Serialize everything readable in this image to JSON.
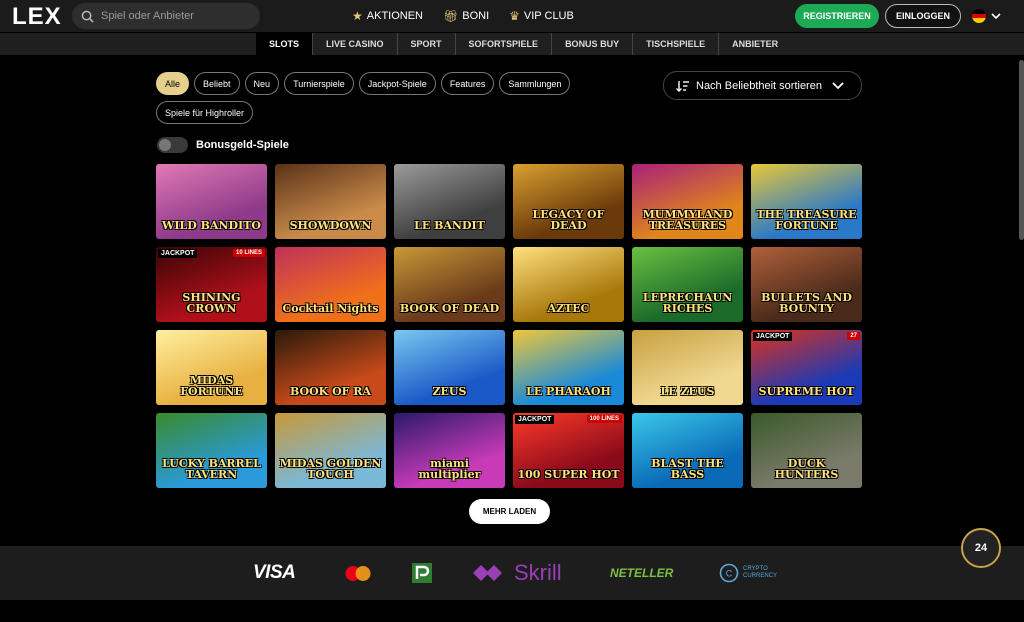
{
  "header": {
    "logo": "LEX",
    "search_placeholder": "Spiel oder Anbieter",
    "nav": [
      {
        "label": "AKTIONEN",
        "icon": "star-icon"
      },
      {
        "label": "BONI",
        "icon": "gift-icon"
      },
      {
        "label": "VIP CLUB",
        "icon": "crown-icon"
      }
    ],
    "register_label": "REGISTRIEREN",
    "login_label": "EINLOGGEN",
    "language_icon": "germany-flag-icon"
  },
  "categories": {
    "tabs": [
      "SLOTS",
      "LIVE CASINO",
      "SPORT",
      "SOFORTSPIELE",
      "BONUS BUY",
      "TISCHSPIELE",
      "ANBIETER"
    ],
    "active": "SLOTS"
  },
  "filters": {
    "chips": [
      "Alle",
      "Beliebt",
      "Neu",
      "Turnierspiele",
      "Jackpot-Spiele",
      "Features",
      "Sammlungen",
      "Spiele für Highroller"
    ],
    "active": "Alle"
  },
  "sort": {
    "label": "Nach Beliebtheit sortieren"
  },
  "bonus_toggle": {
    "label": "Bonusgeld-Spiele",
    "on": false
  },
  "games": [
    {
      "title": "WILD BANDITO",
      "bg": "#8e3a8a",
      "bg2": "#e07ab5"
    },
    {
      "title": "SHOWDOWN",
      "bg": "#c98a4a",
      "bg2": "#5a3218"
    },
    {
      "title": "LE BANDIT",
      "bg": "#3f3f3f",
      "bg2": "#9a9a9a"
    },
    {
      "title": "LEGACY OF DEAD",
      "bg": "#6b3a0a",
      "bg2": "#d8a030"
    },
    {
      "title": "MUMMYLAND TREASURES",
      "bg": "#e0861a",
      "bg2": "#a8207a"
    },
    {
      "title": "THE TREASURE FORTUNE",
      "bg": "#2a78c8",
      "bg2": "#e8c838"
    },
    {
      "title": "SHINING CROWN",
      "bg": "#b0101a",
      "bg2": "#3a0505",
      "jackpot": "JACKPOT",
      "lines": "10 LINES"
    },
    {
      "title": "Cocktail Nights",
      "bg": "#f0701a",
      "bg2": "#c0305a"
    },
    {
      "title": "BOOK OF DEAD",
      "bg": "#6a3a1a",
      "bg2": "#c89838"
    },
    {
      "title": "AZTEC",
      "bg": "#a8780a",
      "bg2": "#ffe080"
    },
    {
      "title": "LEPRECHAUN RICHES",
      "bg": "#1a6a2a",
      "bg2": "#6ac040"
    },
    {
      "title": "BULLETS AND BOUNTY",
      "bg": "#4a2a1a",
      "bg2": "#b0603a"
    },
    {
      "title": "MIDAS FORTUNE",
      "bg": "#e8b040",
      "bg2": "#fff0a0"
    },
    {
      "title": "BOOK OF RA",
      "bg": "#c84a1a",
      "bg2": "#2a1a0a"
    },
    {
      "title": "ZEUS",
      "bg": "#1a5ac8",
      "bg2": "#7ac8f0"
    },
    {
      "title": "LE PHARAOH",
      "bg": "#1a8ad8",
      "bg2": "#f0c83a"
    },
    {
      "title": "LE ZEUS",
      "bg": "#f0d890",
      "bg2": "#c8a040"
    },
    {
      "title": "SUPREME HOT",
      "bg": "#1a3ab8",
      "bg2": "#e0301a",
      "jackpot": "JACKPOT",
      "lines": "27"
    },
    {
      "title": "LUCKY BARREL TAVERN",
      "bg": "#2a9ad8",
      "bg2": "#3a8a2a"
    },
    {
      "title": "MIDAS GOLDEN TOUCH",
      "bg": "#7ab8d8",
      "bg2": "#c89838"
    },
    {
      "title": "miami multiplier",
      "bg": "#c83ab8",
      "bg2": "#2a1a6a"
    },
    {
      "title": "100 SUPER HOT",
      "bg": "#8a0a1a",
      "bg2": "#ff3a2a",
      "jackpot": "JACKPOT",
      "lines": "100 LINES"
    },
    {
      "title": "BLAST THE BASS",
      "bg": "#0a6ab8",
      "bg2": "#3ac8e8"
    },
    {
      "title": "DUCK HUNTERS",
      "bg": "#7a7a6a",
      "bg2": "#3a5a2a"
    }
  ],
  "load_more_label": "MEHR LADEN",
  "support_label": "24",
  "footer": {
    "payments": [
      "VISA",
      "Mastercard",
      "PayPal",
      "Skrill",
      "NETELLER",
      "CRYPTO CURRENCY"
    ]
  }
}
